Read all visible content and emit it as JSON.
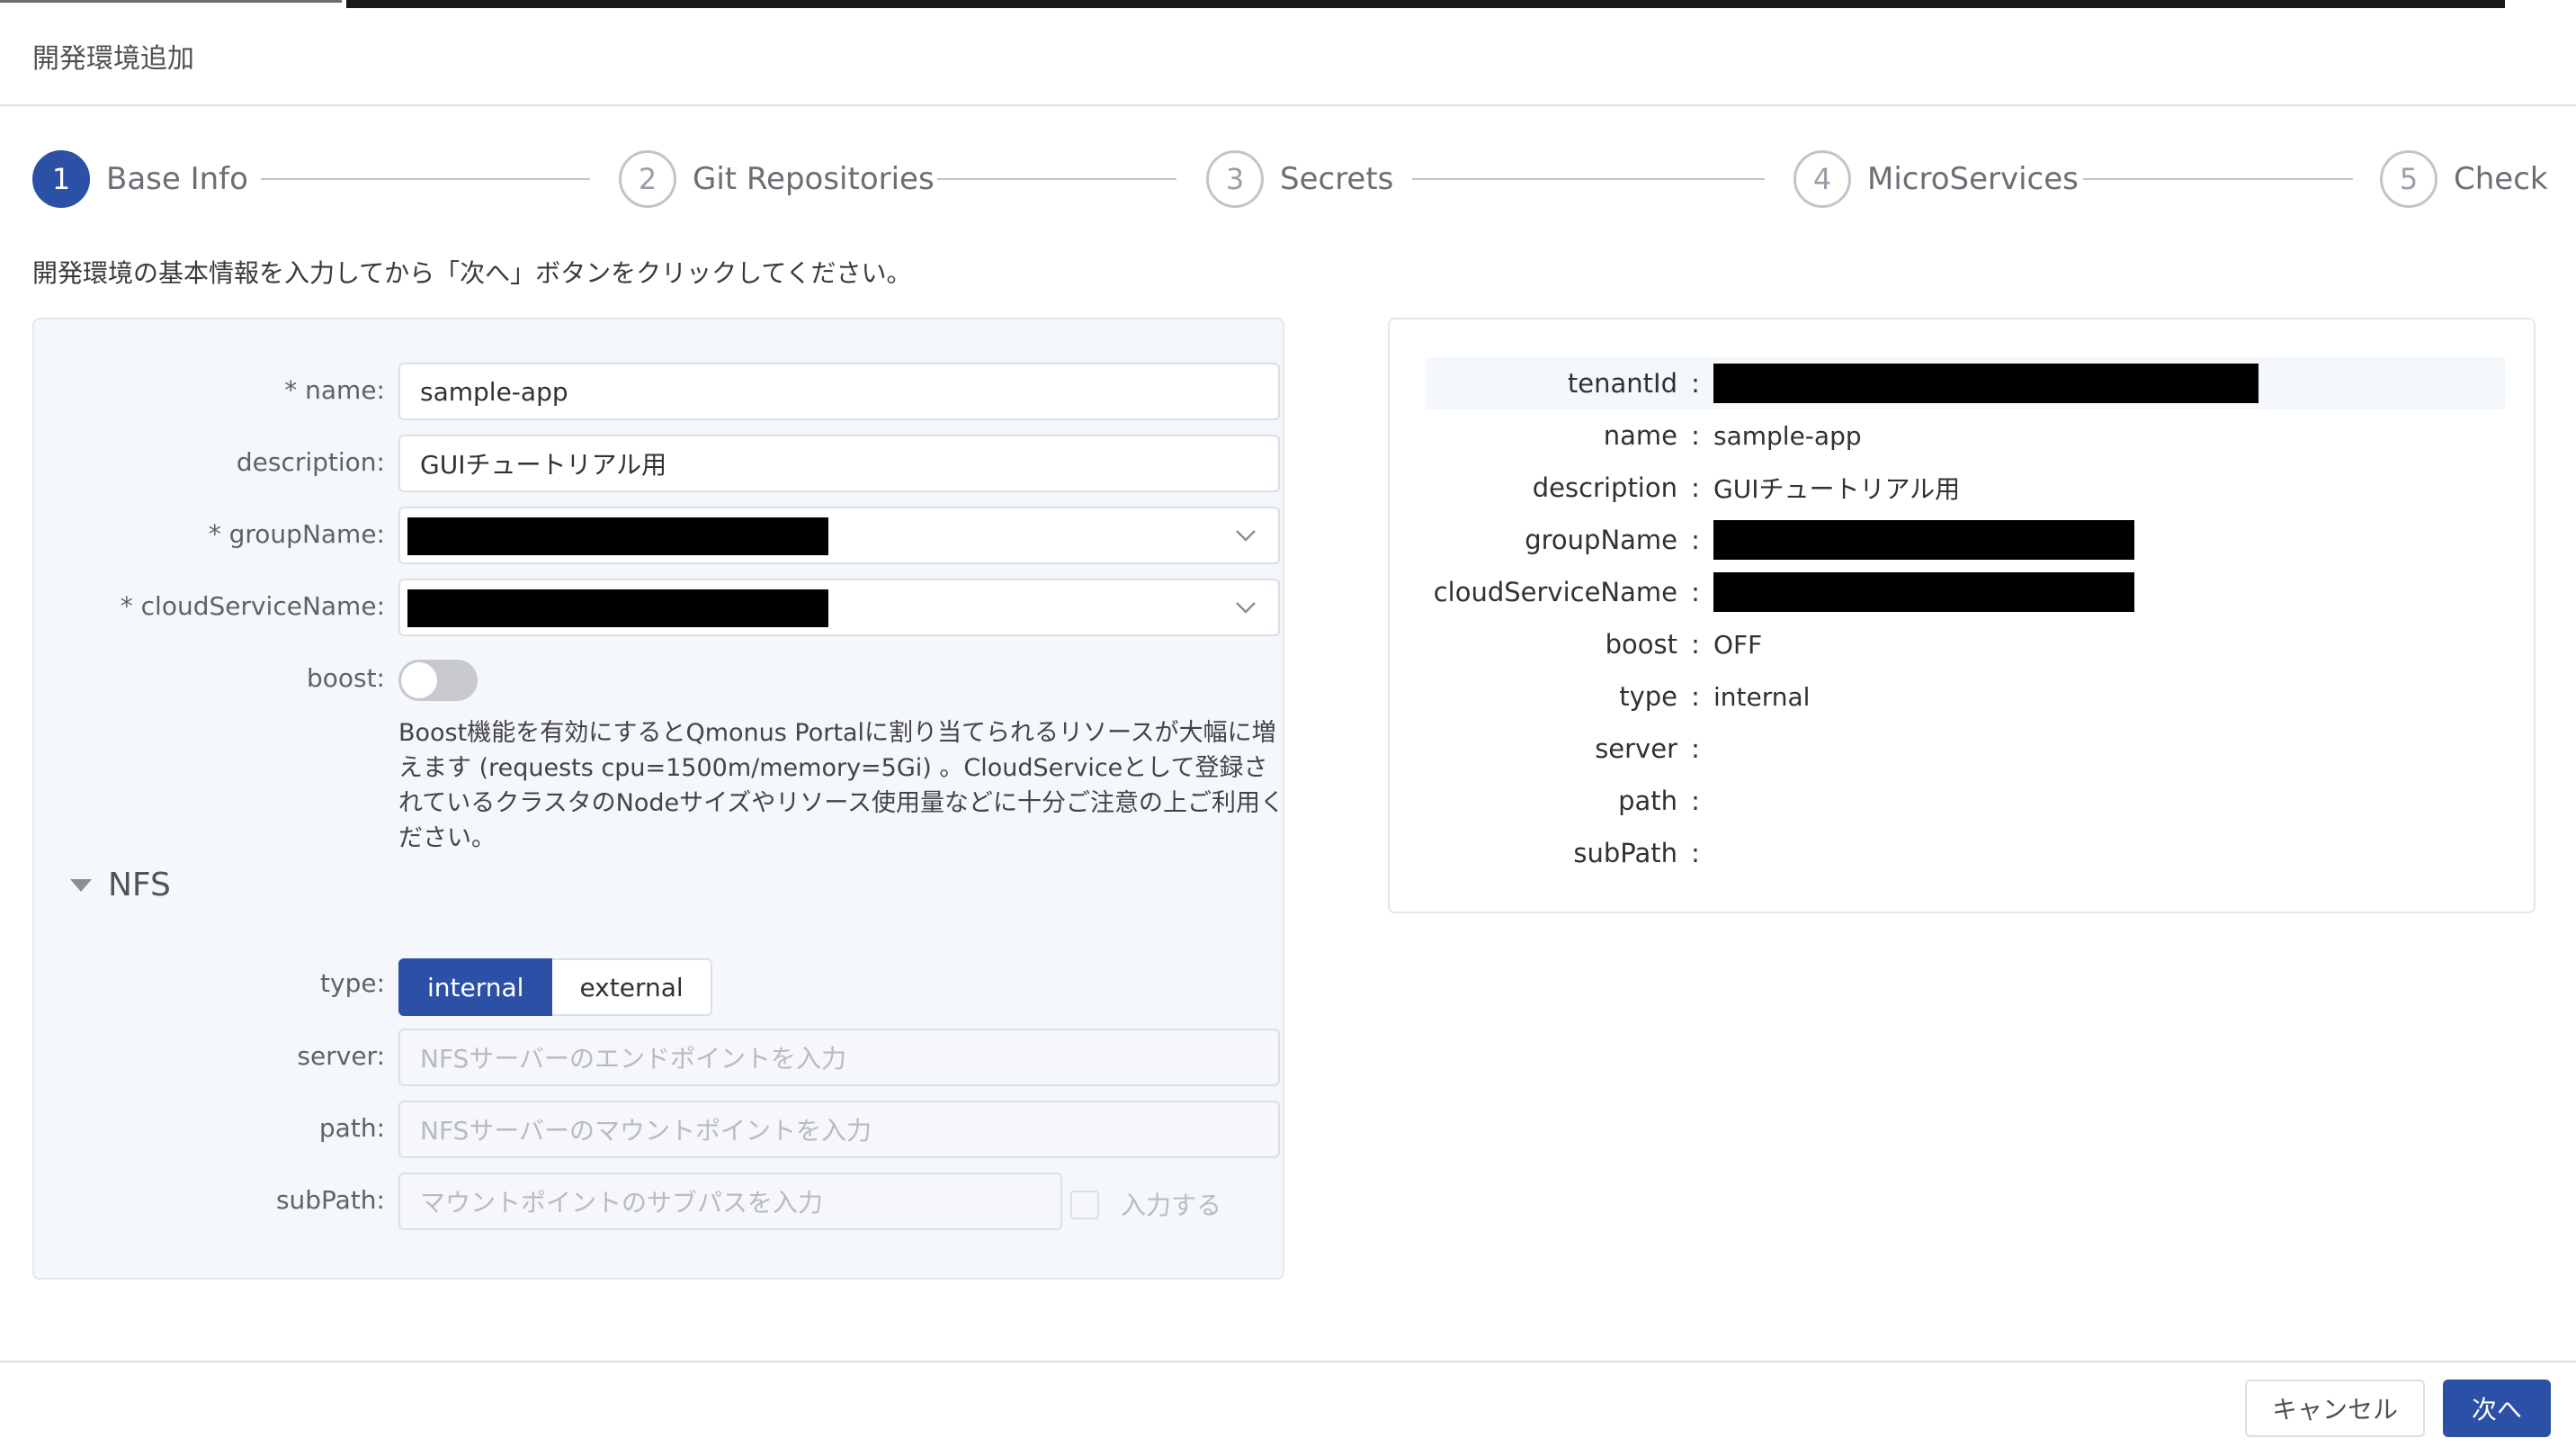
{
  "dialog": {
    "title": "開発環境追加"
  },
  "steps": [
    {
      "number": "1",
      "label": "Base Info",
      "active": true
    },
    {
      "number": "2",
      "label": "Git Repositories",
      "active": false
    },
    {
      "number": "3",
      "label": "Secrets",
      "active": false
    },
    {
      "number": "4",
      "label": "MicroServices",
      "active": false
    },
    {
      "number": "5",
      "label": "Check",
      "active": false
    }
  ],
  "hint": "開発環境の基本情報を入力してから「次へ」ボタンをクリックしてください。",
  "form": {
    "name": {
      "label": "* name:",
      "value": "sample-app"
    },
    "description": {
      "label": "description:",
      "value": "GUIチュートリアル用"
    },
    "groupName": {
      "label": "* groupName:",
      "value": ""
    },
    "cloudServiceName": {
      "label": "* cloudServiceName:",
      "value": ""
    },
    "boost": {
      "label": "boost:",
      "enabled": false,
      "description": "Boost機能を有効にするとQmonus Portalに割り当てられるリソースが大幅に増えます (requests cpu=1500m/memory=5Gi) 。CloudServiceとして登録されているクラスタのNodeサイズやリソース使用量などに十分ご注意の上ご利用ください。"
    },
    "nfs": {
      "title": "NFS",
      "type": {
        "label": "type:",
        "options": [
          "internal",
          "external"
        ],
        "selected": "internal"
      },
      "server": {
        "label": "server:",
        "placeholder": "NFSサーバーのエンドポイントを入力"
      },
      "path": {
        "label": "path:",
        "placeholder": "NFSサーバーのマウントポイントを入力"
      },
      "subPath": {
        "label": "subPath:",
        "placeholder": "マウントポイントのサブパスを入力",
        "checkbox_label": "入力する",
        "checked": false
      }
    }
  },
  "summary": {
    "rows": [
      {
        "key": "tenantId",
        "value": ""
      },
      {
        "key": "name",
        "value": "sample-app"
      },
      {
        "key": "description",
        "value": "GUIチュートリアル用"
      },
      {
        "key": "groupName",
        "value": ""
      },
      {
        "key": "cloudServiceName",
        "value": ""
      },
      {
        "key": "boost",
        "value": "OFF"
      },
      {
        "key": "type",
        "value": "internal"
      },
      {
        "key": "server",
        "value": ""
      },
      {
        "key": "path",
        "value": ""
      },
      {
        "key": "subPath",
        "value": ""
      }
    ],
    "colon": ":"
  },
  "footer": {
    "cancel_label": "キャンセル",
    "next_label": "次へ"
  },
  "colors": {
    "primary": "#2d50a7",
    "panel_bg": "#f4f7fb",
    "border": "#dcdfe6"
  }
}
